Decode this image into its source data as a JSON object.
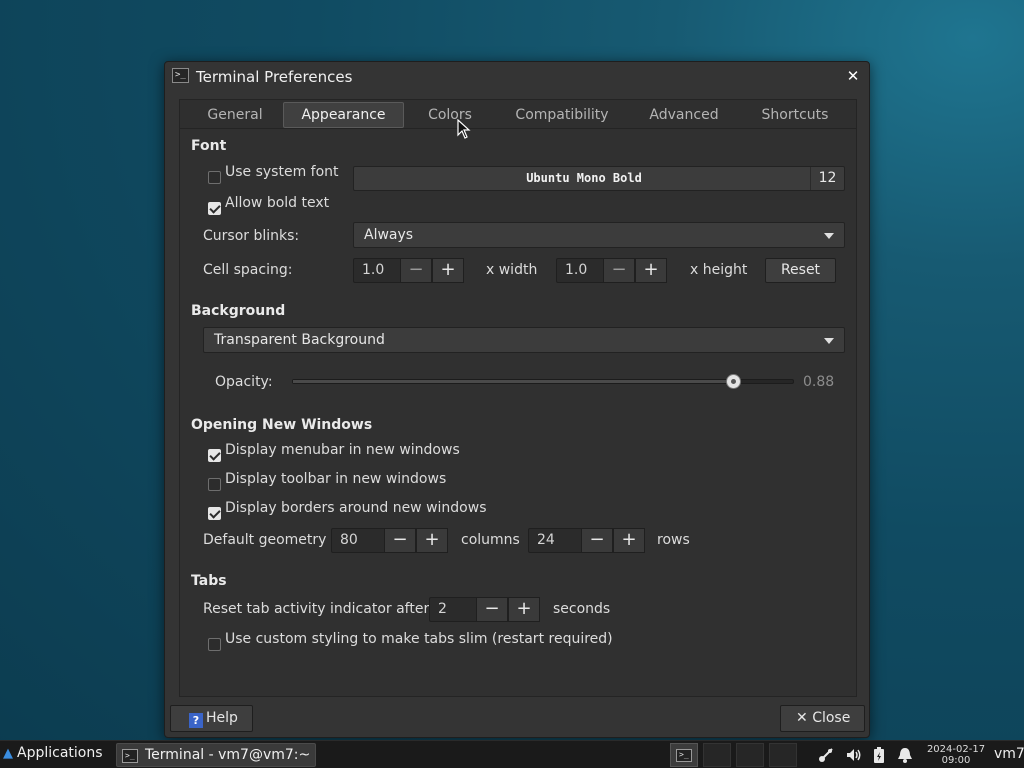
{
  "window": {
    "title": "Terminal Preferences",
    "close_glyph": "✕"
  },
  "tabs": [
    {
      "label": "General",
      "active": false
    },
    {
      "label": "Appearance",
      "active": true
    },
    {
      "label": "Colors",
      "active": false
    },
    {
      "label": "Compatibility",
      "active": false
    },
    {
      "label": "Advanced",
      "active": false
    },
    {
      "label": "Shortcuts",
      "active": false
    }
  ],
  "font_section": {
    "title": "Font",
    "use_system_font": {
      "label": "Use system font",
      "checked": false
    },
    "font_name": "Ubuntu Mono Bold",
    "font_size": "12",
    "allow_bold": {
      "label": "Allow bold text",
      "checked": true
    },
    "cursor_blinks_label": "Cursor blinks:",
    "cursor_blinks_value": "Always",
    "cell_spacing_label": "Cell spacing:",
    "width_value": "1.0",
    "width_suffix": "x width",
    "height_value": "1.0",
    "height_suffix": "x height",
    "reset_label": "Reset"
  },
  "background_section": {
    "title": "Background",
    "mode_value": "Transparent Background",
    "opacity_label": "Opacity:",
    "opacity_value": "0.88",
    "opacity_fraction": 0.88
  },
  "windows_section": {
    "title": "Opening New Windows",
    "menubar": {
      "label": "Display menubar in new windows",
      "checked": true
    },
    "toolbar": {
      "label": "Display toolbar in new windows",
      "checked": false
    },
    "borders": {
      "label": "Display borders around new windows",
      "checked": true
    },
    "geometry_label": "Default geometry",
    "columns_value": "80",
    "columns_suffix": "columns",
    "rows_value": "24",
    "rows_suffix": "rows"
  },
  "tabs_section": {
    "title": "Tabs",
    "reset_indicator_label": "Reset tab activity indicator after",
    "reset_indicator_value": "2",
    "reset_indicator_suffix": "seconds",
    "slim_tabs": {
      "label": "Use custom styling to make tabs slim (restart required)",
      "checked": false
    }
  },
  "buttons": {
    "help_icon": "?",
    "help": "Help",
    "close_glyph": "✕",
    "close": "Close"
  },
  "taskbar": {
    "applications": "Applications",
    "task_label": "Terminal - vm7@vm7:~",
    "date": "2024-02-17",
    "time": "09:00",
    "user": "vm7"
  },
  "icons": {
    "terminal": "terminal-icon",
    "help": "help-icon",
    "close": "close-icon",
    "network": "network-icon",
    "volume": "volume-icon",
    "power": "battery-icon",
    "notifications": "bell-icon"
  },
  "colors": {
    "desktop": "#104b62",
    "window_bg": "#343434",
    "accent_help": "#3a64c8"
  }
}
